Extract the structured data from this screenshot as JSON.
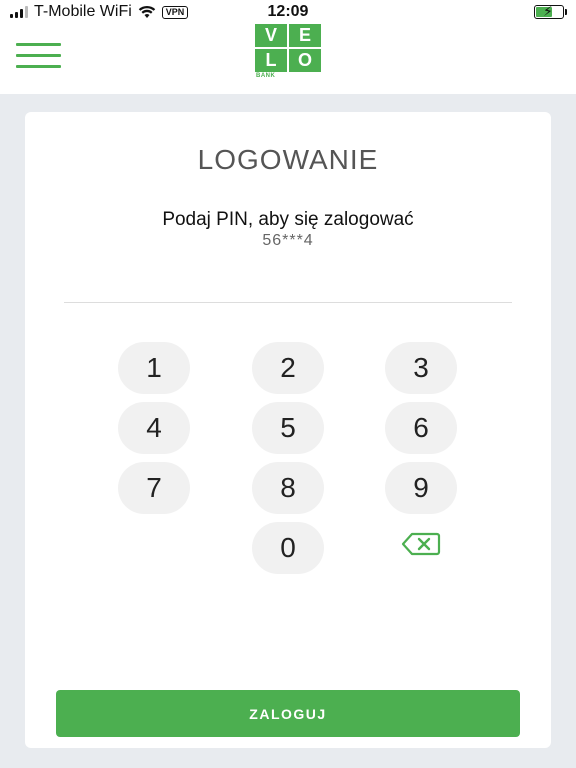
{
  "status_bar": {
    "carrier": "T-Mobile WiFi",
    "vpn": "VPN",
    "time": "12:09"
  },
  "header": {
    "logo_letters": [
      "V",
      "E",
      "L",
      "O"
    ],
    "logo_subtitle": "BANK"
  },
  "login": {
    "title": "LOGOWANIE",
    "prompt": "Podaj PIN, aby się zalogować",
    "masked_account": "56***4",
    "keys": [
      "1",
      "2",
      "3",
      "4",
      "5",
      "6",
      "7",
      "8",
      "9",
      "0"
    ],
    "submit_label": "ZALOGUJ"
  },
  "colors": {
    "brand_green": "#4caf50",
    "page_background": "#e8ebef",
    "key_background": "#f1f1f1"
  },
  "icons": {
    "menu": "hamburger-icon",
    "delete": "backspace-icon",
    "wifi": "wifi-icon",
    "battery": "battery-charging-icon"
  }
}
